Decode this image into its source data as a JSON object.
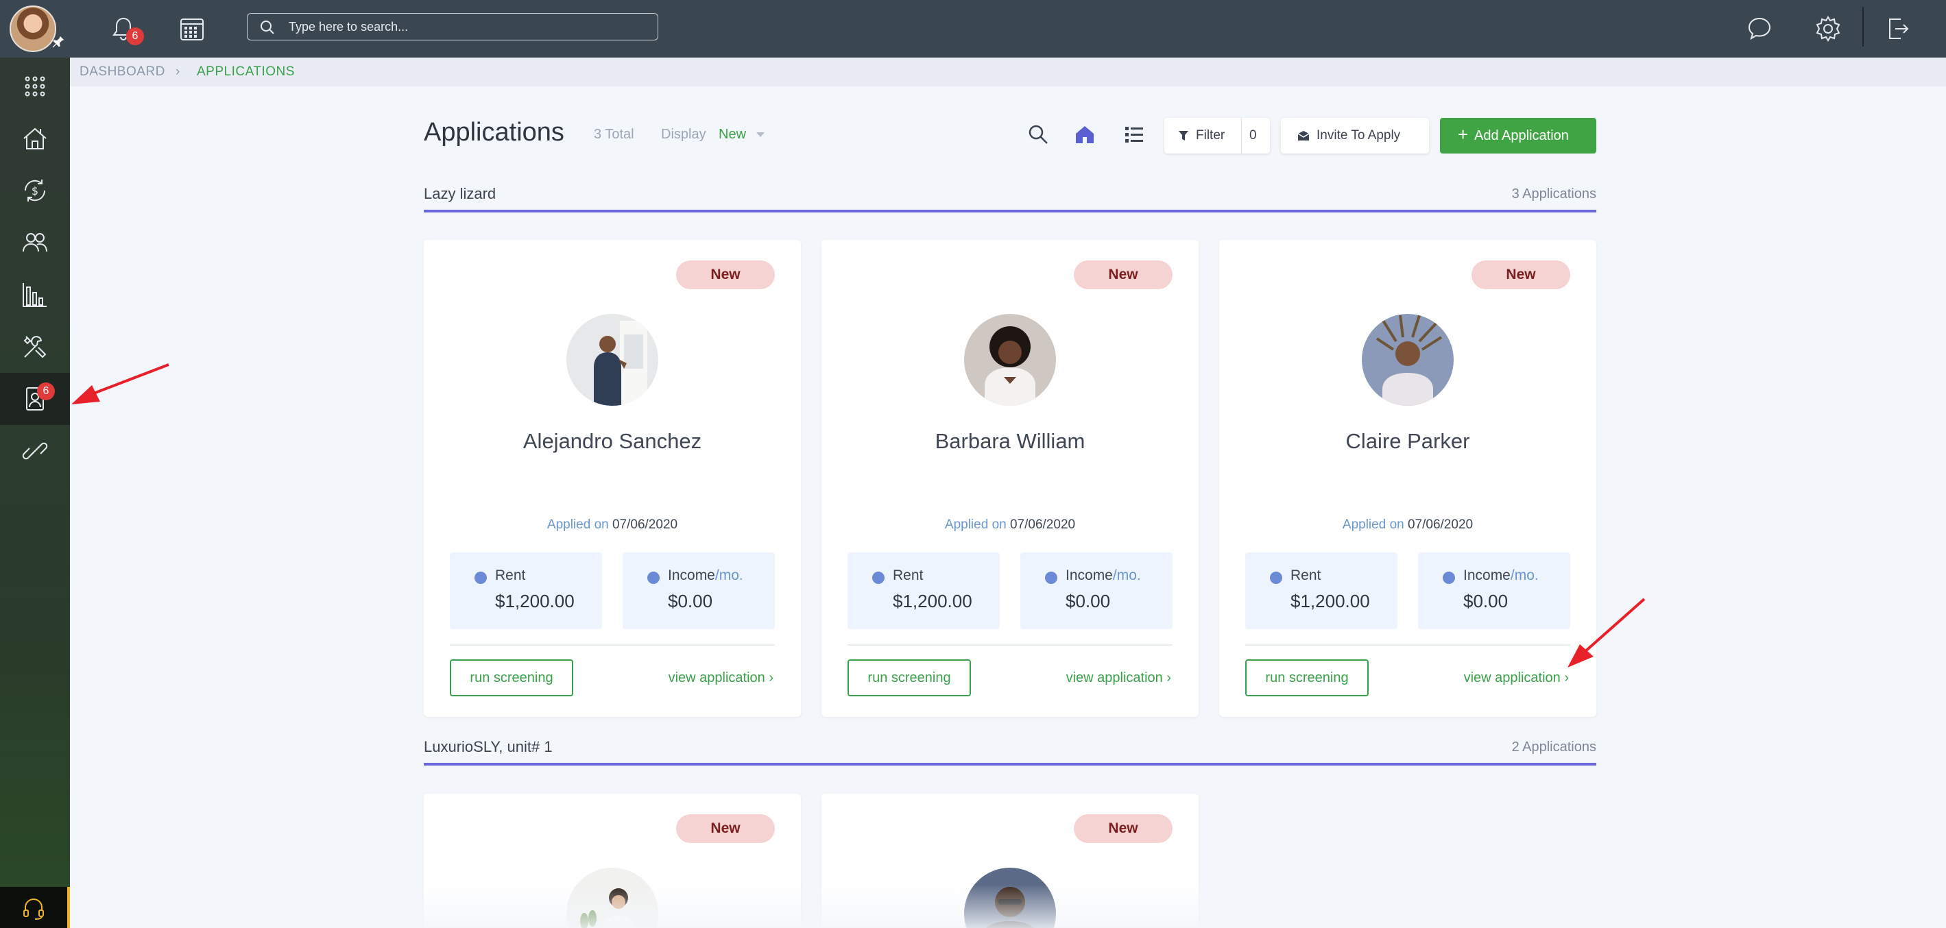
{
  "topbar": {
    "notification_count": "6",
    "search_placeholder": "Type here to search..."
  },
  "sidebar": {
    "applications_badge": "6",
    "items": [
      "grid-icon",
      "home-icon",
      "payments-icon",
      "people-icon",
      "reports-icon",
      "tools-icon",
      "applications-icon",
      "link-icon"
    ]
  },
  "breadcrumb": {
    "home": "DASHBOARD",
    "separator": "›",
    "current": "APPLICATIONS"
  },
  "header": {
    "title": "Applications",
    "total": "3 Total",
    "display_label": "Display",
    "display_value": "New",
    "filter_label": "Filter",
    "filter_count": "0",
    "invite_label": "Invite To Apply",
    "add_label": "Add Application"
  },
  "groups": [
    {
      "title": "Lazy lizard",
      "count": "3 Applications",
      "cards": [
        {
          "status": "New",
          "name": "Alejandro Sanchez",
          "applied_label": "Applied on",
          "applied_date": "07/06/2020",
          "rent_label": "Rent",
          "rent_value": "$1,200.00",
          "income_label": "Income",
          "income_unit": "/mo.",
          "income_value": "$0.00",
          "run_label": "run screening",
          "view_label": "view application ›"
        },
        {
          "status": "New",
          "name": "Barbara William",
          "applied_label": "Applied on",
          "applied_date": "07/06/2020",
          "rent_label": "Rent",
          "rent_value": "$1,200.00",
          "income_label": "Income",
          "income_unit": "/mo.",
          "income_value": "$0.00",
          "run_label": "run screening",
          "view_label": "view application ›"
        },
        {
          "status": "New",
          "name": "Claire Parker",
          "applied_label": "Applied on",
          "applied_date": "07/06/2020",
          "rent_label": "Rent",
          "rent_value": "$1,200.00",
          "income_label": "Income",
          "income_unit": "/mo.",
          "income_value": "$0.00",
          "run_label": "run screening",
          "view_label": "view application ›"
        }
      ]
    },
    {
      "title": "LuxurioSLY, unit# 1",
      "count": "2 Applications",
      "cards": [
        {
          "status": "New"
        },
        {
          "status": "New"
        }
      ]
    }
  ],
  "colors": {
    "topbar": "#3a4650",
    "accent_green": "#40a445",
    "group_line": "#6b68d9",
    "badge_bg": "#f6d3d3",
    "annotation_arrow": "#e8202a"
  }
}
